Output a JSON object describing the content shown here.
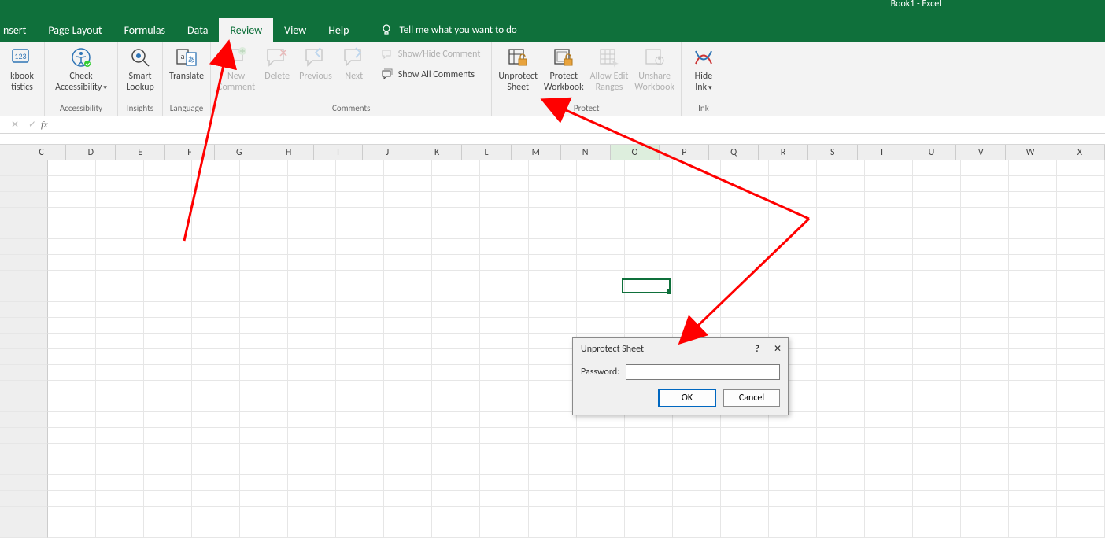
{
  "title": "Book1  -  Excel",
  "tabs": {
    "insert": "nsert",
    "pageLayout": "Page Layout",
    "formulas": "Formulas",
    "data": "Data",
    "review": "Review",
    "view": "View",
    "help": "Help",
    "tellme": "Tell me what you want to do"
  },
  "ribbon": {
    "proofing": {
      "workbookStats1": "kbook",
      "workbookStats2": "tistics"
    },
    "accessibility": {
      "label": "Accessibility",
      "check1": "Check",
      "check2": "Accessibility"
    },
    "insights": {
      "label": "Insights",
      "smart1": "Smart",
      "smart2": "Lookup"
    },
    "language": {
      "label": "Language",
      "translate": "Translate"
    },
    "comments": {
      "label": "Comments",
      "new1": "New",
      "new2": "Comment",
      "delete": "Delete",
      "previous": "Previous",
      "next": "Next",
      "showhide": "Show/Hide Comment",
      "showall": "Show All Comments"
    },
    "protect": {
      "label": "Protect",
      "unprotect1": "Unprotect",
      "unprotect2": "Sheet",
      "protectwb1": "Protect",
      "protectwb2": "Workbook",
      "allow1": "Allow Edit",
      "allow2": "Ranges",
      "unshare1": "Unshare",
      "unshare2": "Workbook"
    },
    "ink": {
      "label": "Ink",
      "hide1": "Hide",
      "hide2": "Ink"
    }
  },
  "fx": {
    "sym": "fx"
  },
  "columns": [
    "C",
    "D",
    "E",
    "F",
    "G",
    "H",
    "I",
    "J",
    "K",
    "L",
    "M",
    "N",
    "O",
    "P",
    "Q",
    "R",
    "S",
    "T",
    "U",
    "V",
    "W",
    "X"
  ],
  "selectedCol": "O",
  "dialog": {
    "title": "Unprotect Sheet",
    "help": "?",
    "close": "✕",
    "password": "Password:",
    "ok": "OK",
    "cancel": "Cancel"
  }
}
